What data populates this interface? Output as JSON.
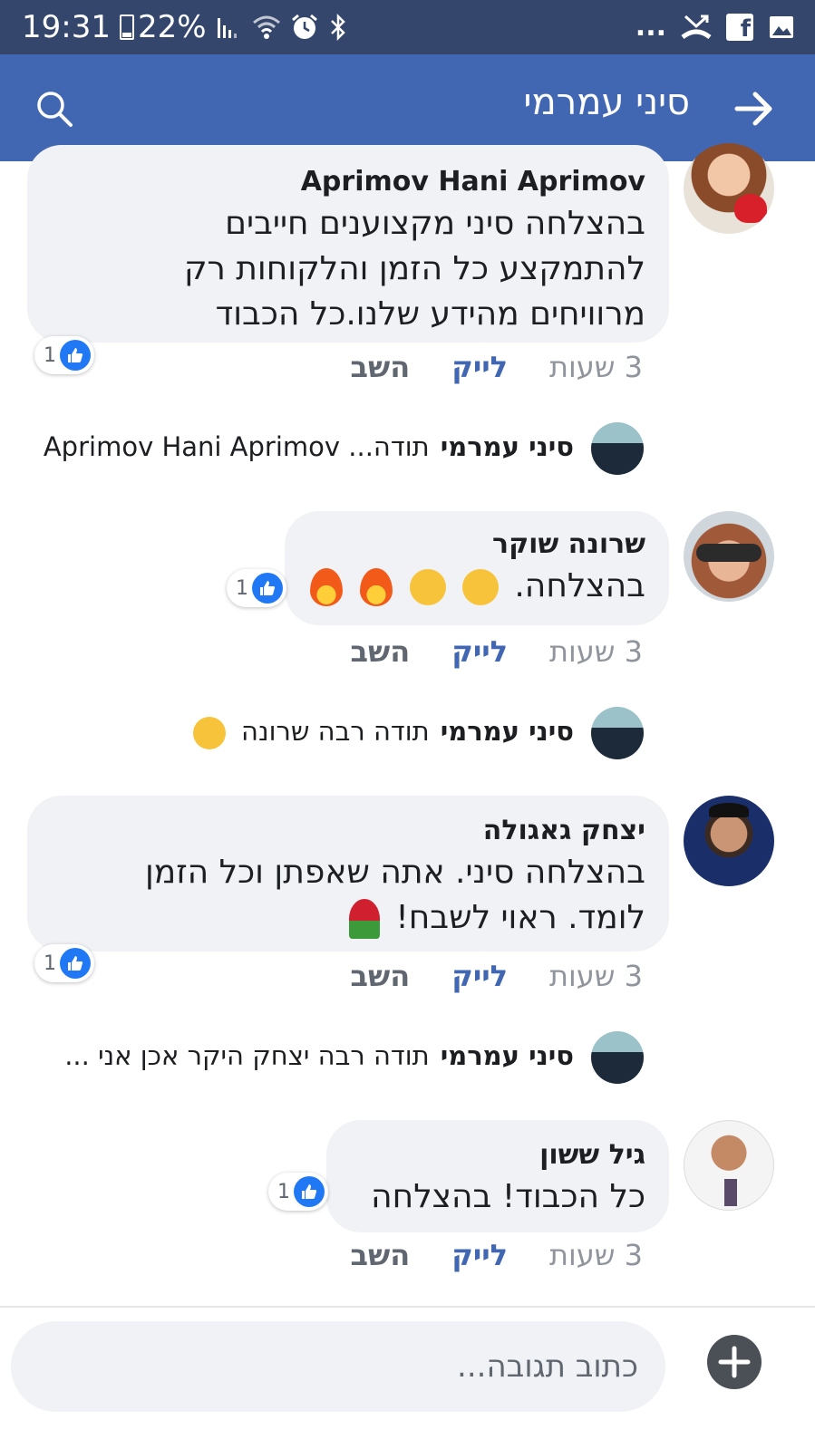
{
  "status_bar": {
    "time": "19:31",
    "battery": "22%",
    "overflow": "..."
  },
  "app_bar": {
    "title": "סיני עמרמי"
  },
  "comments": [
    {
      "author": "Aprimov Hani Aprimov",
      "lines": [
        "בהצלחה סיני מקצוענים חייבים",
        "להתמקצע כל הזמן והלקוחות רק",
        "מרוויחים מהידע שלנו.כל הכבוד"
      ],
      "like_count": "1",
      "time": "3 שעות",
      "like_label": "לייק",
      "reply_label": "השב",
      "reply": {
        "author": "סיני עמרמי",
        "text": "תודה... Aprimov Hani Aprimov"
      }
    },
    {
      "author": "שרונה שוקר",
      "text": "בהצלחה.",
      "like_count": "1",
      "time": "3 שעות",
      "like_label": "לייק",
      "reply_label": "השב",
      "reply": {
        "author": "סיני עמרמי",
        "text": "תודה רבה שרונה"
      }
    },
    {
      "author": "יצחק גאגולה",
      "lines": [
        "בהצלחה סיני. אתה שאפתן וכל הזמן",
        "לומד. ראוי לשבח!"
      ],
      "like_count": "1",
      "time": "3 שעות",
      "like_label": "לייק",
      "reply_label": "השב",
      "reply": {
        "author": "סיני עמרמי",
        "text": "תודה רבה יצחק היקר אכן אני ..."
      }
    },
    {
      "author": "גיל ששון",
      "text": "כל הכבוד! בהצלחה",
      "like_count": "1",
      "time": "3 שעות",
      "like_label": "לייק",
      "reply_label": "השב"
    }
  ],
  "composer": {
    "placeholder": "כתוב תגובה..."
  },
  "colors": {
    "status_bar": "#34466b",
    "app_bar": "#4267b2",
    "bubble": "#f0f2f5",
    "like_blue": "#2078f4"
  },
  "icons": [
    "search-icon",
    "back-arrow-icon",
    "thumbs-up-icon",
    "plus-icon",
    "battery-icon",
    "wifi-icon",
    "alarm-icon",
    "bluetooth-icon",
    "facebook-icon",
    "gallery-icon"
  ]
}
